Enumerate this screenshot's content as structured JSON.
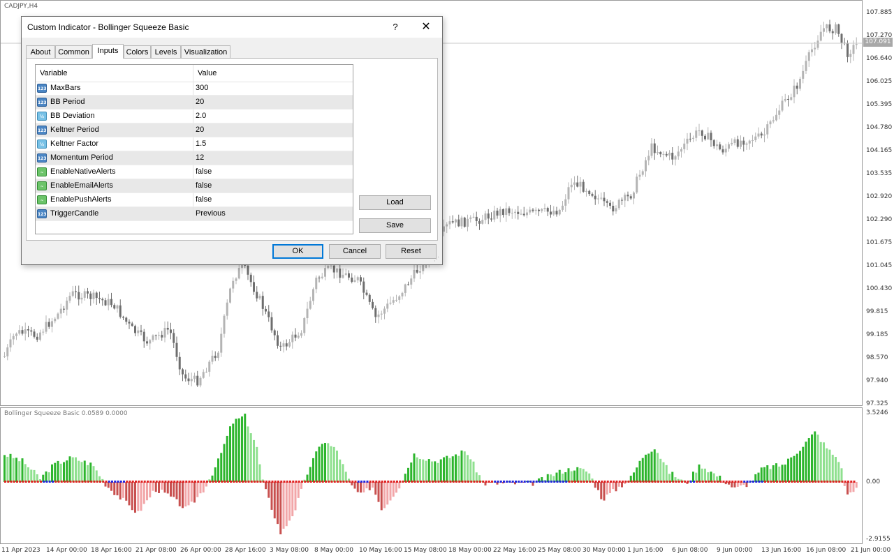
{
  "chart": {
    "symbol": "CADJPY,H4",
    "current_price": "107.091",
    "price_labels": [
      "107.885",
      "107.270",
      "106.640",
      "106.025",
      "105.395",
      "104.780",
      "104.165",
      "103.535",
      "102.920",
      "102.290",
      "101.675",
      "101.045",
      "100.430",
      "99.815",
      "99.185",
      "98.570",
      "97.940",
      "97.325"
    ],
    "indicator_title": "Bollinger Squeeze Basic 0.0589 0.0000",
    "indicator_levels": [
      "3.5246",
      "0.00",
      "-2.9155"
    ],
    "time_labels": [
      "11 Apr 2023",
      "14 Apr 00:00",
      "18 Apr 16:00",
      "21 Apr 08:00",
      "26 Apr 00:00",
      "28 Apr 16:00",
      "3 May 08:00",
      "8 May 00:00",
      "10 May 16:00",
      "15 May 08:00",
      "18 May 00:00",
      "22 May 16:00",
      "25 May 08:00",
      "30 May 00:00",
      "1 Jun 16:00",
      "6 Jun 08:00",
      "9 Jun 00:00",
      "13 Jun 16:00",
      "16 Jun 08:00",
      "21 Jun 00:00"
    ],
    "colors": {
      "bull_candle": "#b4b4b4",
      "bear_candle": "#6e6e6e",
      "hist_up_strong": "#2db52d",
      "hist_up_weak": "#8fe08f",
      "hist_down_strong": "#c8504f",
      "hist_down_weak": "#f2a6a8",
      "squeeze_on": "#e02020",
      "squeeze_off": "#2222dd"
    }
  },
  "dialog": {
    "title": "Custom Indicator - Bollinger Squeeze Basic",
    "help": "?",
    "close": "✕",
    "tabs": [
      "About",
      "Common",
      "Inputs",
      "Colors",
      "Levels",
      "Visualization"
    ],
    "active_tab": "Inputs",
    "grid": {
      "col_variable": "Variable",
      "col_value": "Value",
      "rows": [
        {
          "icon": "int",
          "icon_text": "123",
          "name": "MaxBars",
          "value": "300"
        },
        {
          "icon": "int",
          "icon_text": "123",
          "name": "BB Period",
          "value": "20"
        },
        {
          "icon": "dbl",
          "icon_text": "½",
          "name": "BB Deviation",
          "value": "2.0"
        },
        {
          "icon": "int",
          "icon_text": "123",
          "name": "Keltner Period",
          "value": "20"
        },
        {
          "icon": "dbl",
          "icon_text": "½",
          "name": "Keltner Factor",
          "value": "1.5"
        },
        {
          "icon": "int",
          "icon_text": "123",
          "name": "Momentum Period",
          "value": "12"
        },
        {
          "icon": "bool",
          "icon_text": "~",
          "name": "EnableNativeAlerts",
          "value": "false"
        },
        {
          "icon": "bool",
          "icon_text": "~",
          "name": "EnableEmailAlerts",
          "value": "false"
        },
        {
          "icon": "bool",
          "icon_text": "~",
          "name": "EnablePushAlerts",
          "value": "false"
        },
        {
          "icon": "int",
          "icon_text": "123",
          "name": "TriggerCandle",
          "value": "Previous"
        }
      ]
    },
    "buttons": {
      "load": "Load",
      "save": "Save",
      "ok": "OK",
      "cancel": "Cancel",
      "reset": "Reset"
    }
  }
}
